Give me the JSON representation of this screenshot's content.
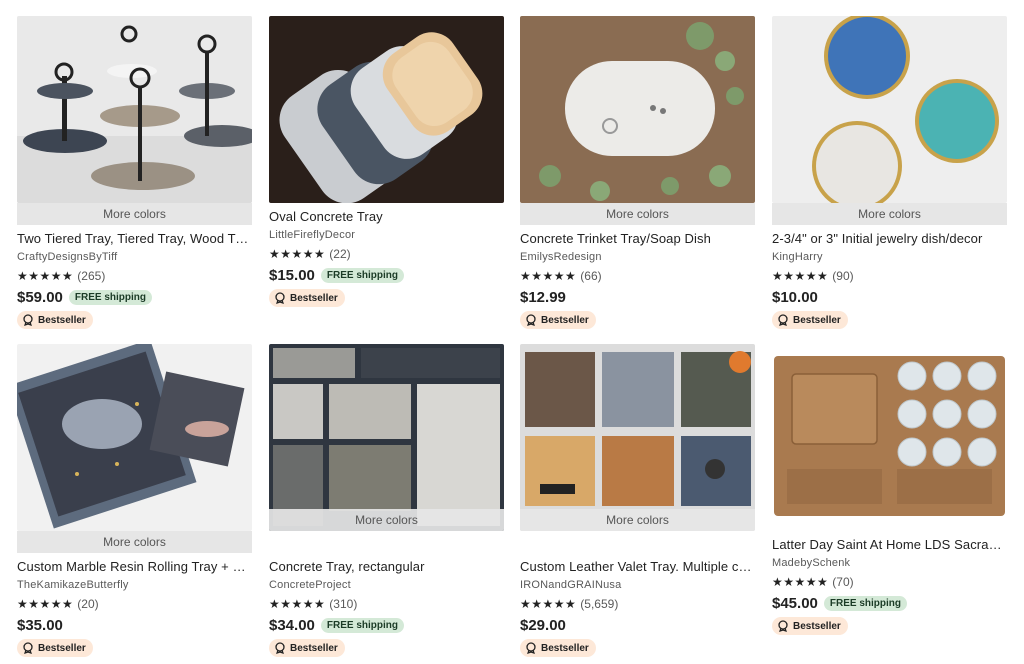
{
  "listings": [
    {
      "title": "Two Tiered Tray, Tiered Tray, Wood Tray",
      "shop": "CraftyDesignsByTiff",
      "stars": "★★★★★",
      "reviews": "(265)",
      "price": "$59.00",
      "free_shipping": "FREE shipping",
      "more_colors": "More colors",
      "badge": "Bestseller",
      "image": "tiered-tray"
    },
    {
      "title": "Oval Concrete Tray",
      "shop": "LittleFireflyDecor",
      "stars": "★★★★★",
      "reviews": "(22)",
      "price": "$15.00",
      "free_shipping": "FREE shipping",
      "more_colors": "",
      "badge": "Bestseller",
      "image": "oval-trays"
    },
    {
      "title": "Concrete Trinket Tray/Soap Dish",
      "shop": "EmilysRedesign",
      "stars": "★★★★★",
      "reviews": "(66)",
      "price": "$12.99",
      "free_shipping": "",
      "more_colors": "More colors",
      "badge": "Bestseller",
      "image": "trinket-tray"
    },
    {
      "title": "2-3/4\" or 3\" Initial jewelry dish/decor",
      "shop": "KingHarry",
      "stars": "★★★★★",
      "reviews": "(90)",
      "price": "$10.00",
      "free_shipping": "",
      "more_colors": "More colors",
      "badge": "Bestseller",
      "image": "jewelry-dishes"
    },
    {
      "title": "Custom Marble Resin Rolling Tray + Coaster",
      "shop": "TheKamikazeButterfly",
      "stars": "★★★★★",
      "reviews": "(20)",
      "price": "$35.00",
      "free_shipping": "",
      "more_colors": "More colors",
      "badge": "Bestseller",
      "image": "marble-tray"
    },
    {
      "title": "Concrete Tray, rectangular",
      "shop": "ConcreteProject",
      "stars": "★★★★★",
      "reviews": "(310)",
      "price": "$34.00",
      "free_shipping": "FREE shipping",
      "more_colors": "More colors",
      "badge": "Bestseller",
      "image": "rect-trays"
    },
    {
      "title": "Custom Leather Valet Tray. Multiple colors",
      "shop": "IRONandGRAINusa",
      "stars": "★★★★★",
      "reviews": "(5,659)",
      "price": "$29.00",
      "free_shipping": "",
      "more_colors": "More colors",
      "badge": "Bestseller",
      "image": "leather-trays"
    },
    {
      "title": "Latter Day Saint At Home LDS Sacrament Tray",
      "shop": "MadebySchenk",
      "stars": "★★★★★",
      "reviews": "(70)",
      "price": "$45.00",
      "free_shipping": "FREE shipping",
      "more_colors": "",
      "badge": "Bestseller",
      "image": "sacrament-tray"
    }
  ],
  "colors": {
    "free_shipping_bg": "#d4e9d7",
    "badge_bg": "#fde8d8",
    "more_colors_bg": "#e6e6e6"
  }
}
